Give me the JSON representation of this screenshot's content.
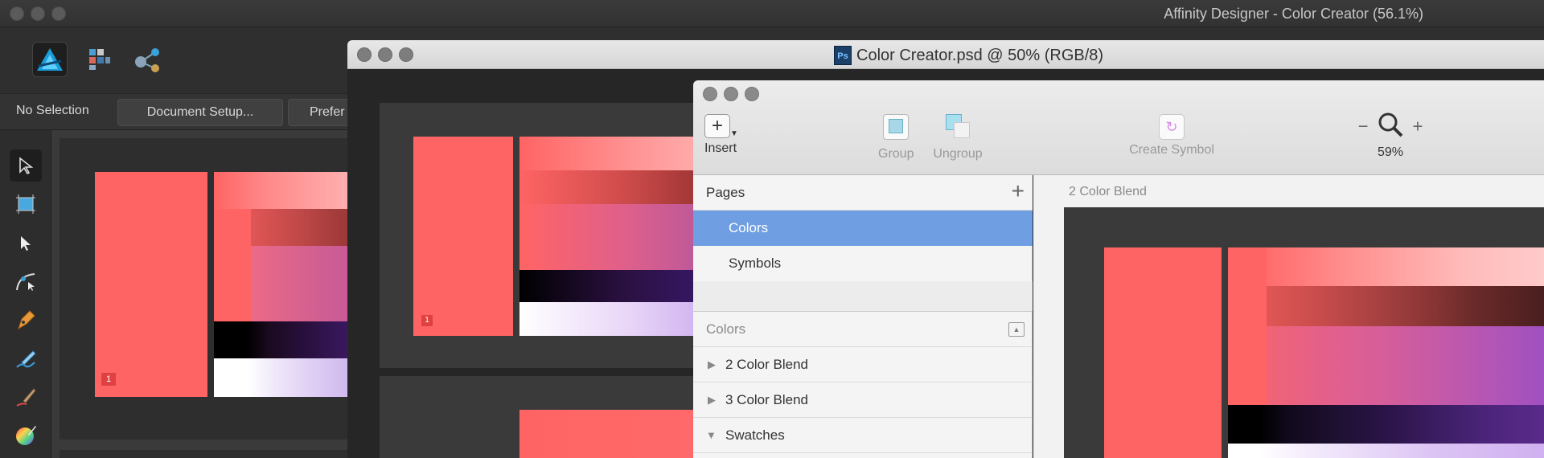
{
  "affinity": {
    "title": "Affinity Designer - Color Creator (56.1%)",
    "context_bar": {
      "selection": "No Selection",
      "document_setup": "Document Setup...",
      "preferences": "Prefer"
    },
    "personas": [
      "designer-persona-icon",
      "pixel-persona-icon",
      "export-persona-icon"
    ],
    "tools": [
      "move-tool-icon",
      "artboard-tool-icon",
      "node-tool-icon",
      "corner-tool-icon",
      "pen-tool-icon",
      "pencil-tool-icon",
      "brush-tool-icon",
      "fill-tool-icon"
    ],
    "artboard_badge": "1"
  },
  "psd": {
    "title": "Color Creator.psd @ 50% (RGB/8)",
    "artboard_badge": "1"
  },
  "sketch": {
    "toolbar": {
      "insert": "Insert",
      "group": "Group",
      "ungroup": "Ungroup",
      "create_symbol": "Create Symbol",
      "zoom": "59%"
    },
    "pages_header": "Pages",
    "pages": [
      "Colors",
      "Symbols"
    ],
    "layers_header": "Colors",
    "layers": [
      "2 Color Blend",
      "3 Color Blend",
      "Swatches"
    ],
    "artboard_label": "2 Color Blend"
  },
  "colors": {
    "coral": "#ff6464",
    "selection_blue": "#6f9fe2",
    "purple": "#5a2a8a"
  }
}
